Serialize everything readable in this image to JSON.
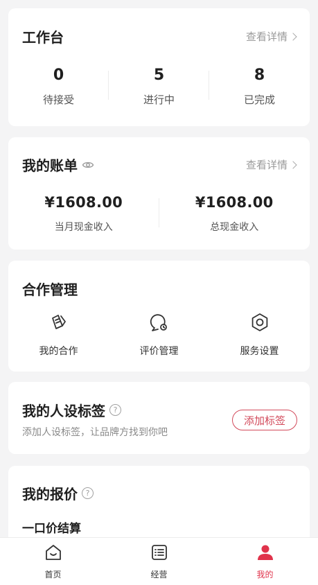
{
  "workbench": {
    "title": "工作台",
    "detail": "查看详情",
    "stats": [
      {
        "value": "0",
        "label": "待接受"
      },
      {
        "value": "5",
        "label": "进行中"
      },
      {
        "value": "8",
        "label": "已完成"
      }
    ]
  },
  "bill": {
    "title": "我的账单",
    "detail": "查看详情",
    "monthly_amount": "¥1608.00",
    "monthly_label": "当月现金收入",
    "total_amount": "¥1608.00",
    "total_label": "总现金收入"
  },
  "cooperation": {
    "title": "合作管理",
    "items": [
      {
        "label": "我的合作",
        "icon": "cooperation-icon"
      },
      {
        "label": "评价管理",
        "icon": "review-icon"
      },
      {
        "label": "服务设置",
        "icon": "settings-icon"
      }
    ]
  },
  "tags": {
    "title": "我的人设标签",
    "subtitle": "添加人设标签，让品牌方找到你吧",
    "button": "添加标签"
  },
  "quote": {
    "title": "我的报价",
    "subtitle": "一口价结算"
  },
  "tabbar": {
    "items": [
      {
        "label": "首页",
        "icon": "home-icon",
        "active": false
      },
      {
        "label": "经营",
        "icon": "list-icon",
        "active": false
      },
      {
        "label": "我的",
        "icon": "profile-icon",
        "active": true
      }
    ],
    "active_color": "#e0334b"
  },
  "colors": {
    "accent": "#e0334b",
    "tag_button": "#d2495a",
    "background": "#f4f4f5"
  }
}
